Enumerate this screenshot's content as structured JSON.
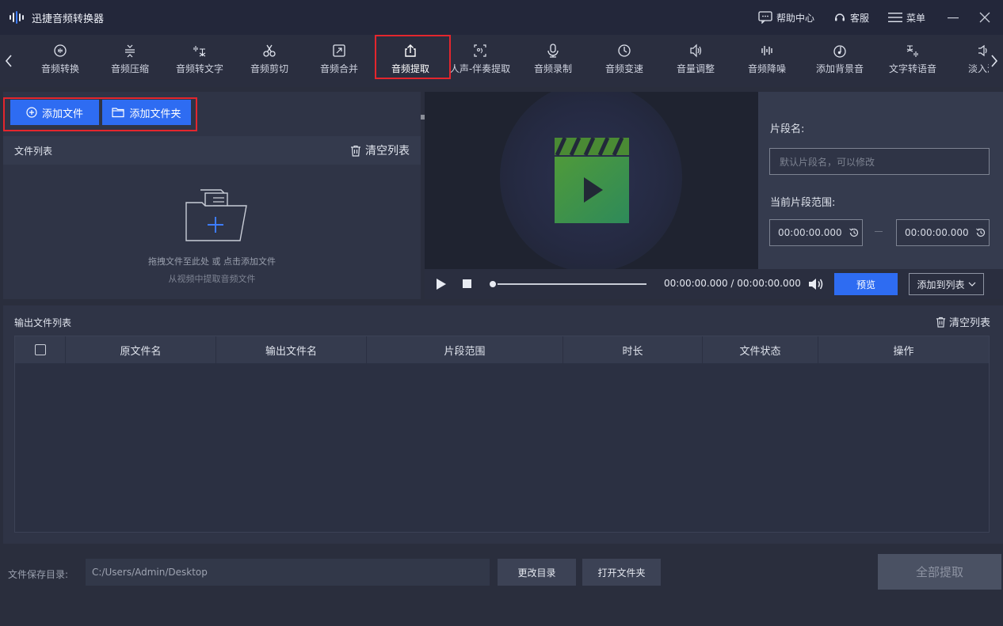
{
  "app": {
    "title": "迅捷音频转换器",
    "help_center": "帮助中心",
    "customer_service": "客服",
    "menu": "菜单"
  },
  "toolbar": {
    "tools": [
      {
        "label": "音频转换",
        "icon": "audio-convert-icon"
      },
      {
        "label": "音频压缩",
        "icon": "audio-compress-icon"
      },
      {
        "label": "音频转文字",
        "icon": "audio-to-text-icon"
      },
      {
        "label": "音频剪切",
        "icon": "scissors-icon"
      },
      {
        "label": "音频合并",
        "icon": "audio-merge-icon"
      },
      {
        "label": "音频提取",
        "icon": "upload-icon",
        "active": true
      },
      {
        "label": "人声-伴奏提取",
        "icon": "vocal-extract-icon"
      },
      {
        "label": "音频录制",
        "icon": "microphone-icon"
      },
      {
        "label": "音频变速",
        "icon": "speed-icon"
      },
      {
        "label": "音量调整",
        "icon": "volume-icon"
      },
      {
        "label": "音频降噪",
        "icon": "waveform-icon"
      },
      {
        "label": "添加背景音",
        "icon": "background-music-icon"
      },
      {
        "label": "文字转语音",
        "icon": "text-to-speech-icon"
      },
      {
        "label": "淡入淡",
        "icon": "fade-icon"
      }
    ],
    "scroll_position": 0.52
  },
  "file_panel": {
    "add_file": "添加文件",
    "add_folder": "添加文件夹",
    "list_title": "文件列表",
    "clear_list": "清空列表",
    "drop_hint": "拖拽文件至此处 或 点击添加文件",
    "drop_sub": "从视频中提取音频文件"
  },
  "player": {
    "time": "00:00:00.000 / 00:00:00.000",
    "progress": 0,
    "preview": "预览",
    "add_to_list": "添加到列表"
  },
  "segment": {
    "name_label": "片段名:",
    "name_placeholder": "默认片段名，可以修改",
    "range_label": "当前片段范围:",
    "start_time": "00:00:00.000",
    "end_time": "00:00:00.000"
  },
  "output": {
    "title": "输出文件列表",
    "clear_list": "清空列表",
    "columns": [
      "原文件名",
      "输出文件名",
      "片段范围",
      "时长",
      "文件状态",
      "操作"
    ],
    "rows": []
  },
  "footer": {
    "save_label": "文件保存目录:",
    "save_path": "C:/Users/Admin/Desktop",
    "change_dir": "更改目录",
    "open_folder": "打开文件夹",
    "extract_all": "全部提取"
  },
  "colors": {
    "accent": "#2e6cf2",
    "highlight": "#e3262d",
    "background": "#2a2e3d"
  }
}
